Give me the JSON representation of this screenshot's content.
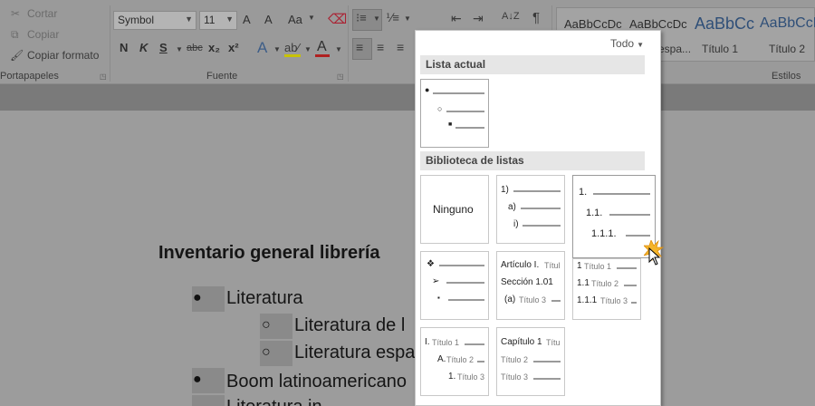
{
  "ribbon": {
    "clipboard": {
      "cut": "Cortar",
      "copy": "Copiar",
      "format_painter": "Copiar formato",
      "group_label": "Portapapeles"
    },
    "font": {
      "name": "Symbol",
      "size": "11",
      "grow": "A",
      "shrink": "A",
      "case": "Aa",
      "bold": "N",
      "italic": "K",
      "underline": "S",
      "strike": "abc",
      "subscript": "x₂",
      "superscript": "x²",
      "group_label": "Fuente"
    },
    "paragraph": {
      "sort": "A↓Z",
      "pilcrow": "¶"
    },
    "styles": {
      "group_label": "Estilos",
      "items": [
        {
          "preview": "AaBbCcDc",
          "name": ""
        },
        {
          "preview": "AaBbCcDc",
          "name": "espa..."
        },
        {
          "preview": "AaBbCc",
          "name": "Título 1"
        },
        {
          "preview": "AaBbCcD",
          "name": "Título 2"
        }
      ]
    }
  },
  "document": {
    "title": "Inventario general librería",
    "lines": [
      {
        "level": 1,
        "text": "Literatura"
      },
      {
        "level": 2,
        "text": "Literatura de l"
      },
      {
        "level": 2,
        "text": "Literatura espa"
      },
      {
        "level": 1,
        "text": "Boom latinoamericano"
      },
      {
        "level": 1,
        "text": "Literatura in"
      }
    ]
  },
  "dropdown": {
    "filter": "Todo",
    "current_header": "Lista actual",
    "library_header": "Biblioteca de listas",
    "tiles": {
      "none": "Ninguno",
      "alpha": [
        "1)",
        "a)",
        "i)"
      ],
      "numeric": [
        "1.",
        "1.1.",
        "1.1.1."
      ],
      "bullets": [
        "❖",
        "➢",
        "▪"
      ],
      "articulo": [
        "Artículo I.",
        "Títul",
        "Sección 1.01",
        "(a)",
        "Título 3"
      ],
      "headings": [
        "1",
        "Título 1",
        "1.1",
        "Título 2",
        "1.1.1",
        "Título 3"
      ],
      "roman": [
        "I.",
        "Título 1",
        "A.",
        "Título 2",
        "1.",
        "Título 3"
      ],
      "capitulo": [
        "Capítulo 1",
        "Títu",
        "Título 2",
        "Título 3"
      ]
    }
  },
  "colors": {
    "panel_bg": "#ffffff",
    "header_bg": "#e6e6e6",
    "ribbon_dim": "#9a9a9a",
    "cursor_glow": "#f2a81d"
  }
}
